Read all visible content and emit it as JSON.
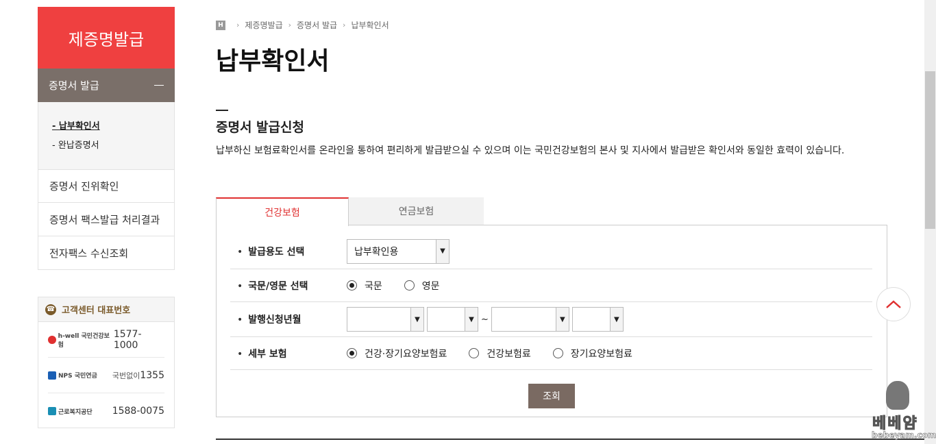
{
  "sidebar": {
    "header": "제증명발급",
    "submenu": {
      "label": "증명서 발급"
    },
    "subitems": [
      "- 납부확인서",
      "- 완납증명서"
    ],
    "items": [
      "증명서 진위확인",
      "증명서 팩스발급 처리결과",
      "전자팩스 수신조회"
    ]
  },
  "customer_center": {
    "title": "고객센터 대표번호",
    "rows": [
      {
        "logo": "h-well 국민건강보험",
        "number": "1577-1000",
        "prefix": ""
      },
      {
        "logo": "NPS 국민연금",
        "number": "1355",
        "prefix": "국번없이"
      },
      {
        "logo": "근로복지공단",
        "number": "1588-0075",
        "prefix": ""
      }
    ]
  },
  "breadcrumb": {
    "home": "H",
    "items": [
      "제증명발급",
      "증명서 발급",
      "납부확인서"
    ]
  },
  "page_title": "납부확인서",
  "section": {
    "title": "증명서 발급신청",
    "description": "납부하신 보험료확인서를 온라인을 통하여 편리하게 발급받으실 수 있으며 이는 국민건강보험의 본사 및 지사에서 발급받은 확인서와 동일한 효력이 있습니다."
  },
  "tabs": [
    {
      "label": "건강보험",
      "active": true
    },
    {
      "label": "연금보험",
      "active": false
    }
  ],
  "form": {
    "purpose": {
      "label": "발급용도 선택",
      "value": "납부확인용"
    },
    "language": {
      "label": "국문/영문 선택",
      "options": [
        "국문",
        "영문"
      ],
      "selected": 0
    },
    "period": {
      "label": "발행신청년월",
      "tilde": "~"
    },
    "detail": {
      "label": "세부 보험",
      "options": [
        "건강·장기요양보험료",
        "건강보험료",
        "장기요양보험료"
      ],
      "selected": 0
    },
    "submit_label": "조회"
  },
  "watermark": {
    "text": "베베얌",
    "url": "bebeyam.com"
  },
  "colors": {
    "accent": "#ef4040",
    "sidebar_sub": "#7a6f69",
    "button": "#7a6a62"
  },
  "icons": {
    "home": "home-icon",
    "scroll_top": "chevron-up-icon",
    "phone": "phone-icon",
    "select": "chevron-down-icon"
  }
}
